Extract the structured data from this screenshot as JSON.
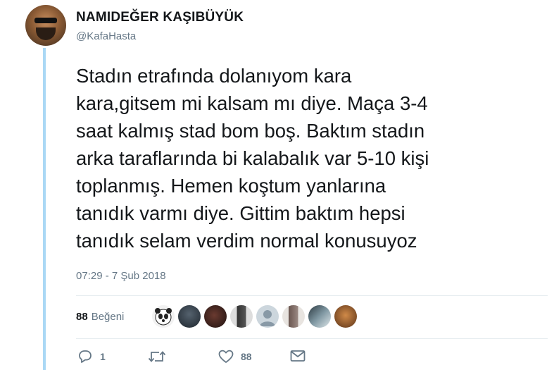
{
  "tweet": {
    "author": {
      "display_name": "NAMIDEĞER KAŞIBÜYÜK",
      "handle": "@KafaHasta"
    },
    "text": "Stadın etrafında dolanıyom kara\nkara,gitsem mi kalsam mı diye. Maça 3-4\nsaat kalmış stad bom boş. Baktım stadın\narka taraflarında bi kalabalık var 5-10 kişi\ntoplanmış. Hemen koştum yanlarına\ntanıdık varmı diye. Gittim baktım hepsi\ntanıdık selam verdim normal konusuyoz",
    "timestamp": "07:29 - 7 Şub 2018"
  },
  "stats": {
    "likes_count": "88",
    "likes_label": "Beğeni"
  },
  "likers": [
    {
      "name": "liker-avatar-1",
      "color": "#d9d9d9"
    },
    {
      "name": "liker-avatar-2",
      "color": "#2c3640"
    },
    {
      "name": "liker-avatar-3",
      "color": "#3a2420"
    },
    {
      "name": "liker-avatar-4",
      "color": "#4a4a4a"
    },
    {
      "name": "liker-avatar-5",
      "color": "#ccd6dd"
    },
    {
      "name": "liker-avatar-6",
      "color": "#7a6a68"
    },
    {
      "name": "liker-avatar-7",
      "color": "#5f7a86"
    },
    {
      "name": "liker-avatar-8",
      "color": "#b0703a"
    }
  ],
  "actions": {
    "reply_count": "1",
    "retweet_count": "",
    "like_count": "88",
    "icons": [
      "reply-icon",
      "retweet-icon",
      "heart-icon",
      "envelope-icon"
    ]
  },
  "colors": {
    "thread_line": "#aad8f5",
    "secondary_text": "#657786",
    "divider": "#e6ecf0"
  }
}
